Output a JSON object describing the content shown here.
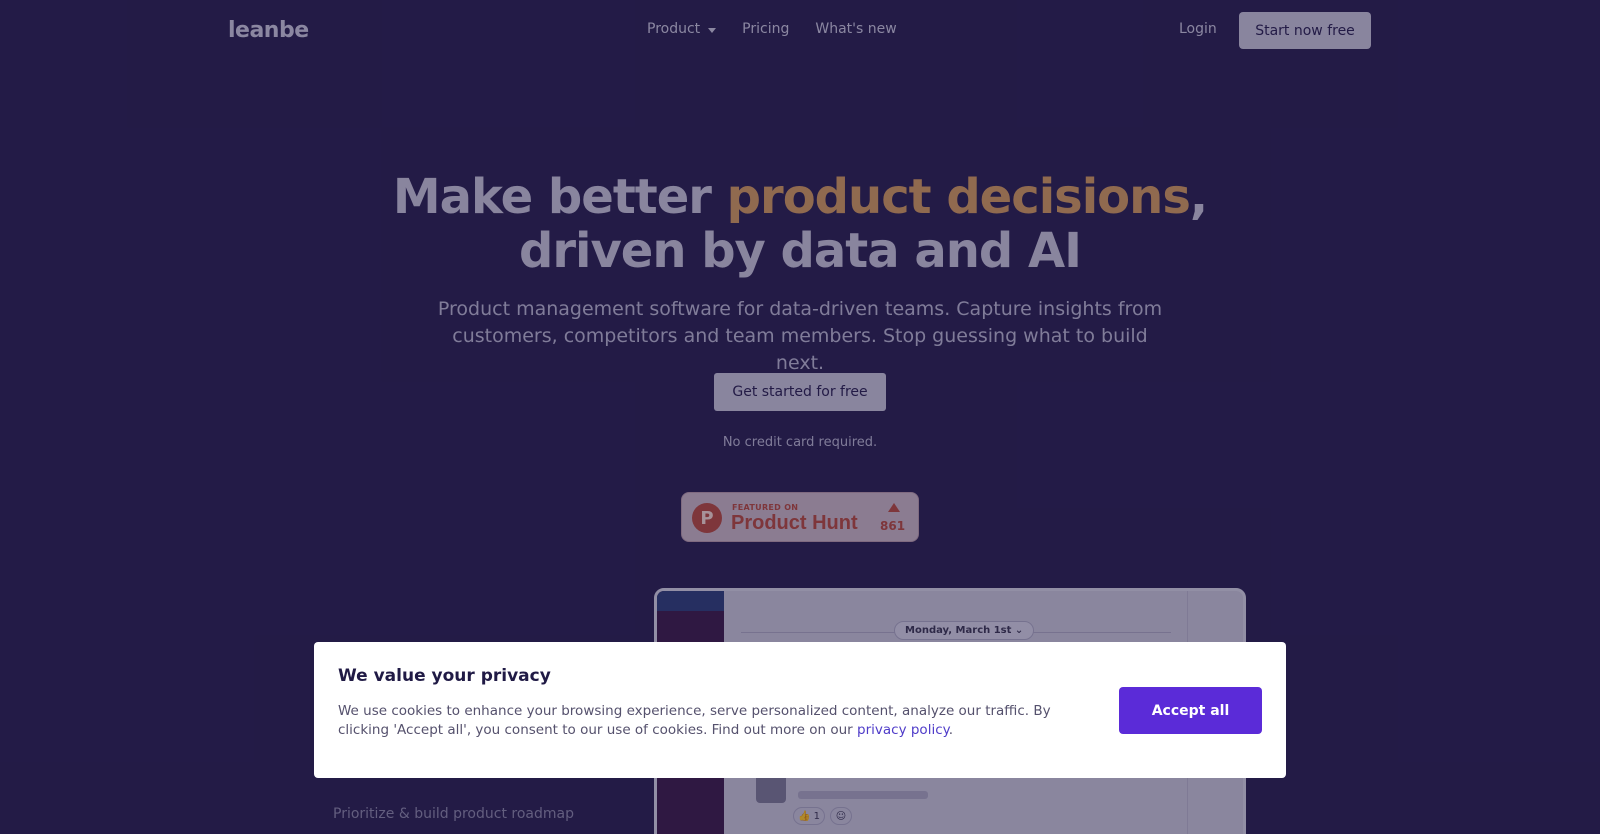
{
  "nav": {
    "logo": "leanbe",
    "links": [
      "Product",
      "Pricing",
      "What's new"
    ],
    "login": "Login",
    "start": "Start now free"
  },
  "hero": {
    "title_part1": "Make better ",
    "title_accent": "product decisions",
    "title_part2": ",",
    "title_line2": "driven by data and AI",
    "subtitle": "Product management software for data-driven teams. Capture insights from customers, competitors and team members. Stop guessing what to build next.",
    "cta": "Get started for free",
    "note": "No credit card required."
  },
  "product_hunt": {
    "featured": "FEATURED ON",
    "name": "Product Hunt",
    "logo_letter": "P",
    "count": "861"
  },
  "app_preview": {
    "date": "Monday, March 1st",
    "reaction_count": "1"
  },
  "feature_label": "Prioritize & build product roadmap",
  "cookie": {
    "title": "We value your privacy",
    "text": "We use cookies to enhance your browsing experience, serve personalized content, analyze our traffic. By clicking 'Accept all', you consent to our use of cookies. Find out more on our ",
    "link": "privacy policy",
    "text_end": ".",
    "accept": "Accept all"
  },
  "colors": {
    "background": "#201a45",
    "accent": "#d19a5f",
    "accept_button": "#5b2bd8",
    "product_hunt": "#b54a3f"
  }
}
